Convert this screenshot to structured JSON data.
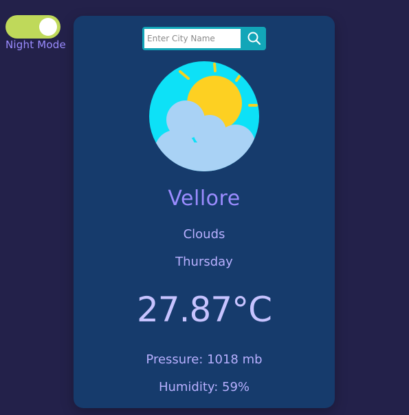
{
  "night_mode": {
    "label": "Night Mode",
    "enabled": true
  },
  "search": {
    "placeholder": "Enter City Name",
    "value": ""
  },
  "weather": {
    "icon": "sun-behind-cloud-icon",
    "city": "Vellore",
    "description": "Clouds",
    "day": "Thursday",
    "temperature": "27.87°C",
    "pressure": "Pressure: 1018 mb",
    "humidity": "Humidity: 59%"
  },
  "colors": {
    "page_bg": "#23214a",
    "card_bg": "#163b6c",
    "toggle_track": "#bfd95a",
    "search_accent": "#12a6b8",
    "text": "#b8b0ff"
  }
}
